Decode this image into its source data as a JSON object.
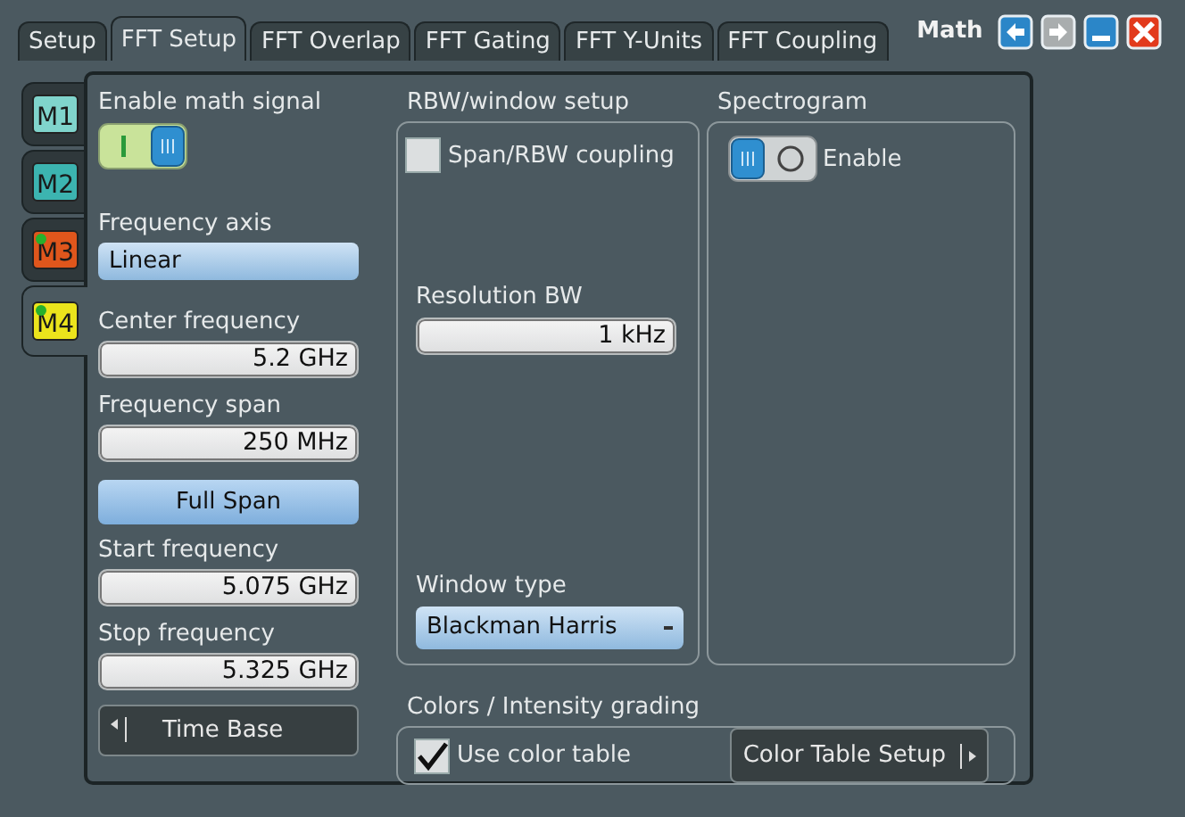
{
  "tabs": [
    {
      "label": "Setup",
      "selected": false
    },
    {
      "label": "FFT Setup",
      "selected": true
    },
    {
      "label": "FFT Overlap",
      "selected": false
    },
    {
      "label": "FFT Gating",
      "selected": false
    },
    {
      "label": "FFT Y-Units",
      "selected": false
    },
    {
      "label": "FFT Coupling",
      "selected": false
    }
  ],
  "title": "Math",
  "window_buttons": [
    {
      "kind": "back",
      "disabled": false
    },
    {
      "kind": "forward",
      "disabled": true
    },
    {
      "kind": "minimize",
      "disabled": false
    },
    {
      "kind": "close",
      "disabled": false
    }
  ],
  "math_tabs": [
    {
      "label": "M1",
      "color": "#80d4cc",
      "active": false,
      "selected": false
    },
    {
      "label": "M2",
      "color": "#3cb4b0",
      "active": false,
      "selected": false
    },
    {
      "label": "M3",
      "color": "#e0561c",
      "active": true,
      "selected": false
    },
    {
      "label": "M4",
      "color": "#ece41c",
      "active": true,
      "selected": true
    }
  ],
  "left_column": [
    {
      "kind": "toggle",
      "label": "Enable math signal",
      "on": true
    },
    {
      "kind": "dropdown",
      "label": "Frequency axis",
      "value": "Linear"
    },
    {
      "kind": "number",
      "label": "Center frequency",
      "value": "5.2 GHz"
    },
    {
      "kind": "number",
      "label": "Frequency span",
      "value": "250 MHz"
    },
    {
      "kind": "button",
      "label": "Full Span"
    },
    {
      "kind": "number",
      "label": "Start frequency",
      "value": "5.075 GHz"
    },
    {
      "kind": "number",
      "label": "Stop frequency",
      "value": "5.325 GHz"
    }
  ],
  "time_base_button": "Time Base",
  "rbw_window_setup": {
    "title": "RBW/window setup",
    "coupling": {
      "label": "Span/RBW coupling",
      "checked": false
    },
    "resolution_bw": {
      "label": "Resolution BW",
      "value": "1 kHz"
    },
    "window_type": {
      "label": "Window type",
      "value": "Blackman Harris"
    }
  },
  "spectrogram": {
    "title": "Spectrogram",
    "enable": {
      "label": "Enable",
      "on": false
    }
  },
  "colors": {
    "title": "Colors / Intensity grading",
    "use_color_table": {
      "label": "Use color table",
      "checked": true
    },
    "setup_button": "Color Table Setup"
  }
}
